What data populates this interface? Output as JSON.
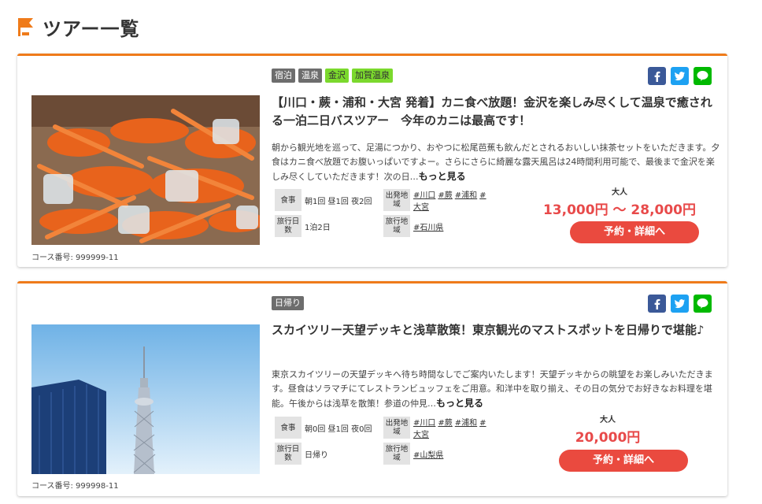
{
  "header": {
    "title": "ツアー一覧"
  },
  "tours": [
    {
      "tags": [
        "宿泊",
        "温泉",
        "金沢",
        "加賀温泉"
      ],
      "title": "【川口・蕨・浦和・大宮 発着】カニ食べ放題！金沢を楽しみ尽くして温泉で癒される一泊二日バスツアー　今年のカニは最高です！",
      "description": "朝から観光地を巡って、足湯につかり、おやつに松尾芭蕉も飲んだとされるおいしい抹茶セットをいただきます。夕食はカニ食べ放題でお腹いっぱいですよー。さらにさらに綺麗な露天風呂は24時間利用可能で、最後まで金沢を楽しみ尽くしていただきます！次の日…",
      "more": "もっと見る",
      "meal_label": "食事",
      "meal": "朝1回 昼1回 夜2回",
      "days_label": "旅行日数",
      "days": "1泊2日",
      "depart_label": "出発地域",
      "depart": [
        "#川口",
        "#蕨",
        "#浦和",
        "#大宮"
      ],
      "area_label": "旅行地域",
      "area": [
        "#石川県"
      ],
      "price_label": "大人",
      "price": "13,000円 〜 28,000円",
      "button": "予約・詳細へ",
      "course_no": "コース番号: 999999-11"
    },
    {
      "tags": [
        "日帰り"
      ],
      "title": "スカイツリー天望デッキと浅草散策！東京観光のマストスポットを日帰りで堪能♪",
      "description": "東京スカイツリーの天望デッキへ待ち時間なしでご案内いたします！天望デッキからの眺望をお楽しみいただきます。昼食はソラマチにてレストランビュッフェをご用意。和洋中を取り揃え、その日の気分でお好きなお料理を堪能。午後からは浅草を散策！参道の仲見…",
      "more": "もっと見る",
      "meal_label": "食事",
      "meal": "朝0回 昼1回 夜0回",
      "days_label": "旅行日数",
      "days": "日帰り",
      "depart_label": "出発地域",
      "depart": [
        "#川口",
        "#蕨",
        "#浦和",
        "#大宮"
      ],
      "area_label": "旅行地域",
      "area": [
        "#山梨県"
      ],
      "price_label": "大人",
      "price": "20,000円",
      "button": "予約・詳細へ",
      "course_no": "コース番号: 999998-11"
    }
  ],
  "colors": {
    "accent": "#ef7b1a",
    "button": "#ea4a3f",
    "price": "#e84a4a",
    "tag_gray": "#6d6d6d",
    "tag_green": "#7bd92d",
    "facebook": "#3b5998",
    "twitter": "#1da1f2",
    "line": "#00b900"
  },
  "icons": [
    "flag-icon",
    "facebook-icon",
    "twitter-icon",
    "line-icon"
  ]
}
